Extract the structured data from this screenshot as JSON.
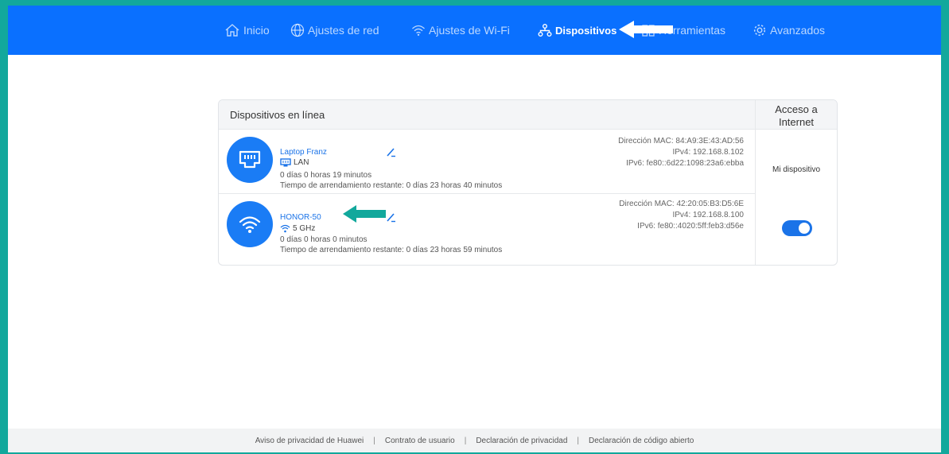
{
  "nav": {
    "items": [
      {
        "label": "Inicio",
        "icon": "home-icon"
      },
      {
        "label": "Ajustes de red",
        "icon": "globe-icon"
      },
      {
        "label": "Ajustes de Wi-Fi",
        "icon": "wifi-icon"
      },
      {
        "label": "Dispositivos",
        "icon": "devices-icon",
        "active": true
      },
      {
        "label": "Herramientas",
        "icon": "tools-icon"
      },
      {
        "label": "Avanzados",
        "icon": "gear-icon"
      }
    ]
  },
  "devices_table": {
    "title": "Dispositivos en línea",
    "access_header_line1": "Acceso a",
    "access_header_line2": "Internet",
    "rows": [
      {
        "name": "Laptop Franz",
        "connection": "LAN",
        "icon": "ethernet-icon",
        "uptime": "0 días 0 horas 19 minutos",
        "lease": "Tiempo de arrendamiento restante: 0 días 23 horas 40 minutos",
        "mac": "Dirección MAC: 84:A9:3E:43:AD:56",
        "ipv4": "IPv4: 192.168.8.102",
        "ipv6": "IPv6: fe80::6d22:1098:23a6:ebba",
        "access": "Mi dispositivo"
      },
      {
        "name": "HONOR-50",
        "connection": "5 GHz",
        "icon": "wifi-icon",
        "uptime": "0 días 0 horas 0 minutos",
        "lease": "Tiempo de arrendamiento restante: 0 días 23 horas 59 minutos",
        "mac": "Dirección MAC: 42:20:05:B3:D5:6E",
        "ipv4": "IPv4: 192.168.8.100",
        "ipv6": "IPv6: fe80::4020:5ff:feb3:d56e",
        "access_enabled": true
      }
    ]
  },
  "footer": {
    "links": [
      "Aviso de privacidad de Huawei",
      "Contrato de usuario",
      "Declaración de privacidad",
      "Declaración de código abierto"
    ]
  },
  "colors": {
    "accent": "#0a70ff",
    "frame": "#12a89c",
    "arrow_annotation": "#12a89c"
  }
}
